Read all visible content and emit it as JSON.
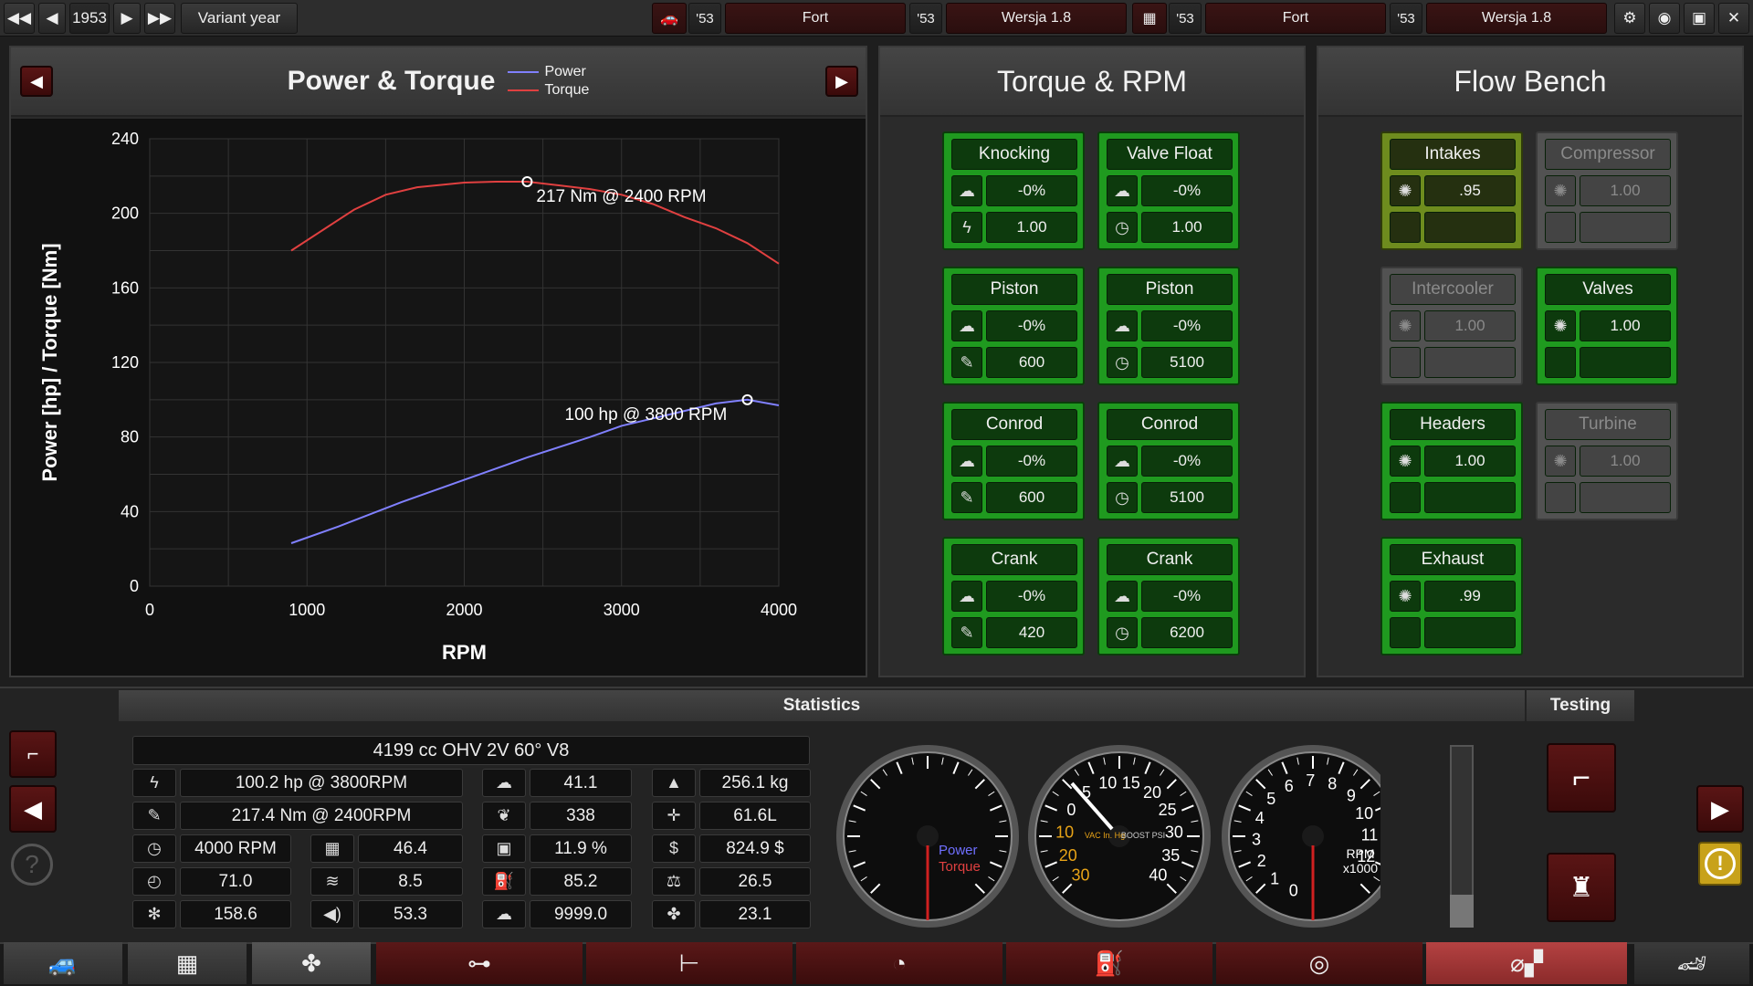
{
  "topbar": {
    "year": "1953",
    "variant_label": "Variant year",
    "model_a": {
      "year": "'53",
      "name": "Fort",
      "variant_year": "'53",
      "variant": "Wersja 1.8"
    },
    "engine_a": {
      "year": "'53",
      "name": "Fort",
      "variant_year": "'53",
      "variant": "Wersja 1.8"
    }
  },
  "power_panel": {
    "title": "Power & Torque",
    "legend": [
      {
        "name": "Power",
        "color": "#8080ff"
      },
      {
        "name": "Torque",
        "color": "#e04040"
      }
    ]
  },
  "chart_data": {
    "type": "line",
    "title": "Power & Torque",
    "xlabel": "RPM",
    "ylabel": "Power [hp] / Torque [Nm]",
    "xlim": [
      0,
      4000
    ],
    "ylim": [
      0,
      240
    ],
    "xticks": [
      0,
      1000,
      2000,
      3000,
      4000
    ],
    "yticks": [
      0,
      40,
      80,
      120,
      160,
      200,
      240
    ],
    "grid": true,
    "legend_position": "top",
    "series": [
      {
        "name": "Power",
        "color": "#8080ff",
        "x": [
          900,
          1200,
          1600,
          2000,
          2400,
          2800,
          3000,
          3200,
          3400,
          3600,
          3800,
          4000
        ],
        "y": [
          23,
          32,
          45,
          57,
          69,
          80,
          86,
          90,
          94,
          98,
          100,
          97
        ]
      },
      {
        "name": "Torque",
        "color": "#e04040",
        "x": [
          900,
          1100,
          1300,
          1500,
          1700,
          2000,
          2200,
          2400,
          2600,
          2800,
          3000,
          3200,
          3400,
          3600,
          3800,
          4000
        ],
        "y": [
          180,
          191,
          202,
          210,
          214,
          216.5,
          217,
          217,
          215,
          213,
          210,
          205,
          198,
          192,
          184,
          173
        ]
      }
    ],
    "annotations": [
      {
        "text": "217 Nm @ 2400 RPM",
        "x": 2400,
        "y": 217
      },
      {
        "text": "100 hp @ 3800 RPM",
        "x": 3800,
        "y": 100
      }
    ]
  },
  "torque_panel": {
    "title": "Torque & RPM",
    "cards": [
      {
        "title": "Knocking",
        "v1": "-0%",
        "v2": "1.00",
        "i1": "cloud-icon",
        "i2": "lightning-icon"
      },
      {
        "title": "Valve Float",
        "v1": "-0%",
        "v2": "1.00",
        "i1": "cloud-icon",
        "i2": "gauge-icon"
      },
      {
        "title": "Piston",
        "v1": "-0%",
        "v2": "600",
        "i1": "cloud-icon",
        "i2": "wrench-icon"
      },
      {
        "title": "Piston",
        "v1": "-0%",
        "v2": "5100",
        "i1": "cloud-icon",
        "i2": "gauge-icon"
      },
      {
        "title": "Conrod",
        "v1": "-0%",
        "v2": "600",
        "i1": "cloud-icon",
        "i2": "wrench-icon"
      },
      {
        "title": "Conrod",
        "v1": "-0%",
        "v2": "5100",
        "i1": "cloud-icon",
        "i2": "gauge-icon"
      },
      {
        "title": "Crank",
        "v1": "-0%",
        "v2": "420",
        "i1": "cloud-icon",
        "i2": "wrench-icon"
      },
      {
        "title": "Crank",
        "v1": "-0%",
        "v2": "6200",
        "i1": "cloud-icon",
        "i2": "gauge-icon"
      }
    ]
  },
  "flow_panel": {
    "title": "Flow Bench",
    "cards": [
      {
        "title": "Intakes",
        "value": ".95",
        "state": "yellow"
      },
      {
        "title": "Compressor",
        "value": "1.00",
        "state": "grey"
      },
      {
        "title": "Intercooler",
        "value": "1.00",
        "state": "grey"
      },
      {
        "title": "Valves",
        "value": "1.00",
        "state": "green"
      },
      {
        "title": "Headers",
        "value": "1.00",
        "state": "green"
      },
      {
        "title": "Turbine",
        "value": "1.00",
        "state": "grey"
      },
      {
        "title": "Exhaust",
        "value": ".99",
        "state": "green"
      }
    ]
  },
  "statistics": {
    "title": "Statistics",
    "testing_label": "Testing",
    "engine_desc": "4199 cc OHV 2V 60° V8",
    "rows": [
      [
        "100.2 hp @ 3800RPM",
        "41.1",
        "256.1 kg"
      ],
      [
        "217.4 Nm @ 2400RPM",
        "338",
        "61.6L"
      ],
      [
        "4000 RPM",
        "46.4",
        "11.9 %",
        "824.9 $"
      ],
      [
        "71.0",
        "8.5",
        "85.2",
        "26.5"
      ],
      [
        "158.6",
        "53.3",
        "9999.0",
        "23.1"
      ]
    ]
  },
  "gauges": {
    "g1": {
      "label1": "Power",
      "label2": "Torque",
      "needle_value": 0
    },
    "g2": {
      "ticks": [
        "30",
        "20",
        "10",
        "0",
        "5",
        "10",
        "15",
        "20",
        "25",
        "30",
        "35",
        "40"
      ],
      "label": "VAC In. Hg",
      "label2": "BOOST PSI"
    },
    "g3": {
      "ticks": [
        "0",
        "1",
        "2",
        "3",
        "4",
        "5",
        "6",
        "7",
        "8",
        "9",
        "10",
        "11",
        "12"
      ],
      "label": "RPM",
      "label2": "x1000"
    }
  }
}
